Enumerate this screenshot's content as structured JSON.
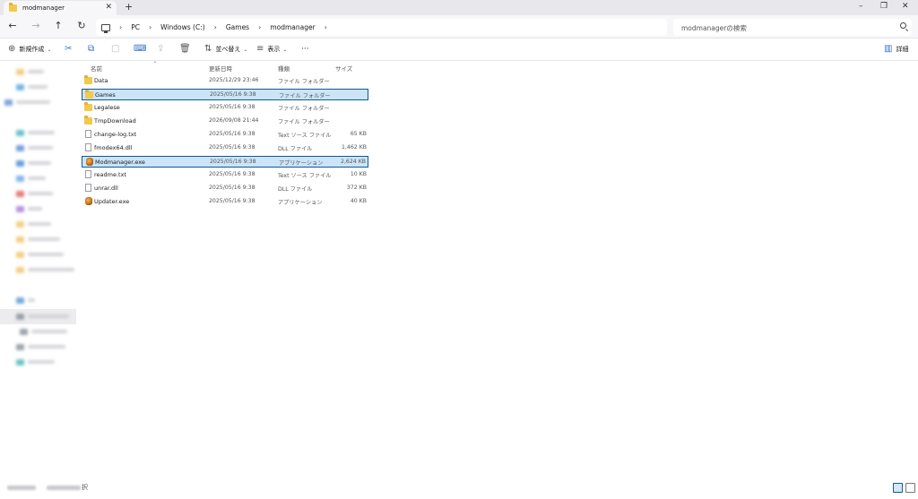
{
  "window": {
    "tab_title": "modmanager",
    "tab_close": "✕",
    "new_tab": "+",
    "minimize": "–",
    "maximize": "❐",
    "close": "✕"
  },
  "address": {
    "crumbs": [
      "PC",
      "Windows (C:)",
      "Games",
      "modmanager"
    ],
    "separator": "›",
    "search_placeholder": "modmanagerの検索"
  },
  "toolbar": {
    "new_label": "新規作成",
    "sort_label": "並べ替え",
    "view_label": "表示",
    "more_label": "···",
    "details_label": "詳細"
  },
  "columns": {
    "name": "名前",
    "date": "更新日時",
    "type": "種類",
    "size": "サイズ"
  },
  "files": [
    {
      "name": "Data",
      "date": "2025/12/29 23:46",
      "type": "ファイル フォルダー",
      "size": "",
      "kind": "folder"
    },
    {
      "name": "Games",
      "date": "2025/05/16 9:38",
      "type": "ファイル フォルダー",
      "size": "",
      "kind": "folder",
      "selected": true
    },
    {
      "name": "Legalese",
      "date": "2025/05/16 9:38",
      "type": "ファイル フォルダー",
      "size": "",
      "kind": "folder"
    },
    {
      "name": "TmpDownload",
      "date": "2026/09/08 21:44",
      "type": "ファイル フォルダー",
      "size": "",
      "kind": "folder"
    },
    {
      "name": "change-log.txt",
      "date": "2025/05/16 9:38",
      "type": "Text ソース ファイル",
      "size": "65 KB",
      "kind": "doc"
    },
    {
      "name": "fmodex64.dll",
      "date": "2025/05/16 9:38",
      "type": "DLL ファイル",
      "size": "1,462 KB",
      "kind": "doc"
    },
    {
      "name": "Modmanager.exe",
      "date": "2025/05/16 9:38",
      "type": "アプリケーション",
      "size": "2,624 KB",
      "kind": "app",
      "selected": true
    },
    {
      "name": "readme.txt",
      "date": "2025/05/16 9:38",
      "type": "Text ソース ファイル",
      "size": "10 KB",
      "kind": "doc"
    },
    {
      "name": "unrar.dll",
      "date": "2025/05/16 9:38",
      "type": "DLL ファイル",
      "size": "372 KB",
      "kind": "doc"
    },
    {
      "name": "Updater.exe",
      "date": "2025/05/16 9:38",
      "type": "アプリケーション",
      "size": "40 KB",
      "kind": "app"
    }
  ],
  "status": {
    "tail": "択"
  },
  "colors": {
    "selection_fill": "#cce4f7",
    "selection_border": "#0e5a92",
    "folder": "#f2c94c"
  }
}
